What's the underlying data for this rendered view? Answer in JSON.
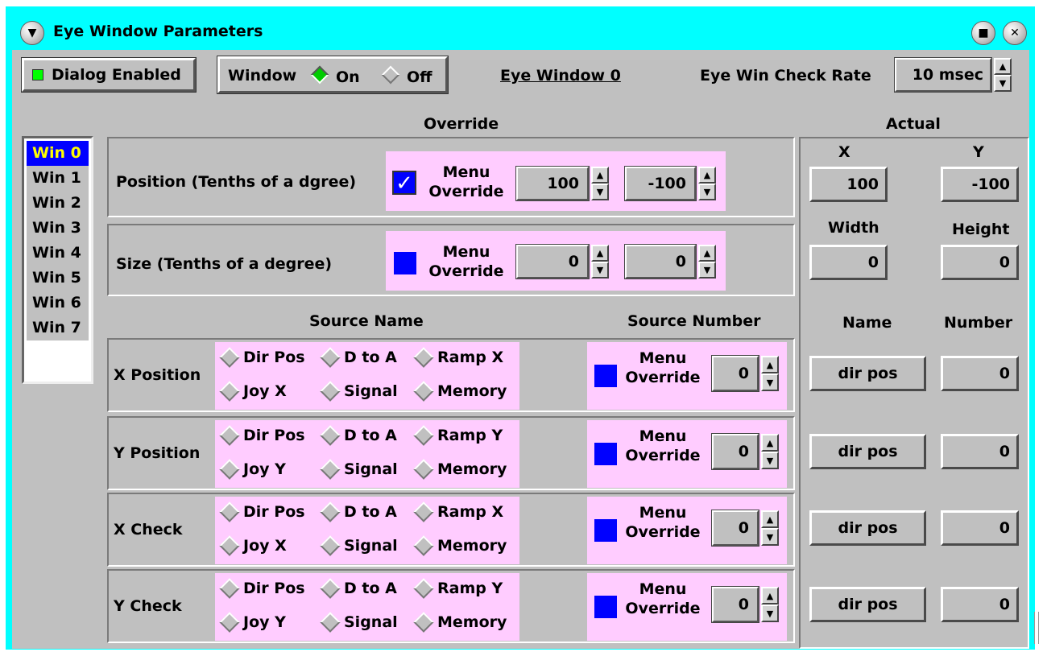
{
  "window": {
    "title": "Eye Window Parameters"
  },
  "toolbar": {
    "dialog_enabled_label": "Dialog Enabled",
    "window_label": "Window",
    "on_label": "On",
    "off_label": "Off",
    "eye_window_label": "Eye Window 0",
    "check_rate_label": "Eye Win Check Rate",
    "check_rate_value": "10 msec"
  },
  "win_list": [
    "Win 0",
    "Win 1",
    "Win 2",
    "Win 3",
    "Win 4",
    "Win 5",
    "Win 6",
    "Win 7"
  ],
  "override": {
    "header": "Override",
    "position": {
      "label": "Position (Tenths of a dgree)",
      "menu": "Menu",
      "override": "Override",
      "x": "100",
      "y": "-100",
      "checked": true
    },
    "size": {
      "label": "Size (Tenths of a degree)",
      "menu": "Menu",
      "override": "Override",
      "x": "0",
      "y": "0",
      "checked": false
    }
  },
  "source": {
    "name_header": "Source Name",
    "number_header": "Source Number",
    "rows": [
      {
        "label": "X Position",
        "opts": [
          "Dir Pos",
          "D to A",
          "Ramp X",
          "Joy X",
          "Signal",
          "Memory"
        ],
        "menu": "Menu",
        "override": "Override",
        "number": "0"
      },
      {
        "label": "Y Position",
        "opts": [
          "Dir Pos",
          "D to A",
          "Ramp Y",
          "Joy Y",
          "Signal",
          "Memory"
        ],
        "menu": "Menu",
        "override": "Override",
        "number": "0"
      },
      {
        "label": "X Check",
        "opts": [
          "Dir Pos",
          "D to A",
          "Ramp X",
          "Joy X",
          "Signal",
          "Memory"
        ],
        "menu": "Menu",
        "override": "Override",
        "number": "0"
      },
      {
        "label": "Y Check",
        "opts": [
          "Dir Pos",
          "D to A",
          "Ramp Y",
          "Joy Y",
          "Signal",
          "Memory"
        ],
        "menu": "Menu",
        "override": "Override",
        "number": "0"
      }
    ]
  },
  "actual": {
    "header": "Actual",
    "x_label": "X",
    "y_label": "Y",
    "x": "100",
    "y": "-100",
    "width_label": "Width",
    "height_label": "Height",
    "width": "0",
    "height": "0",
    "name_label": "Name",
    "number_label": "Number",
    "rows": [
      {
        "name": "dir pos",
        "number": "0"
      },
      {
        "name": "dir pos",
        "number": "0"
      },
      {
        "name": "dir pos",
        "number": "0"
      },
      {
        "name": "dir pos",
        "number": "0"
      }
    ]
  },
  "colors": {
    "titlebar": "#00ffff",
    "panel": "#c0c0c0",
    "pink": "#ffccff",
    "accent": "#0000ff",
    "selected_text": "#ffff00",
    "enabled_led": "#00ff00"
  }
}
